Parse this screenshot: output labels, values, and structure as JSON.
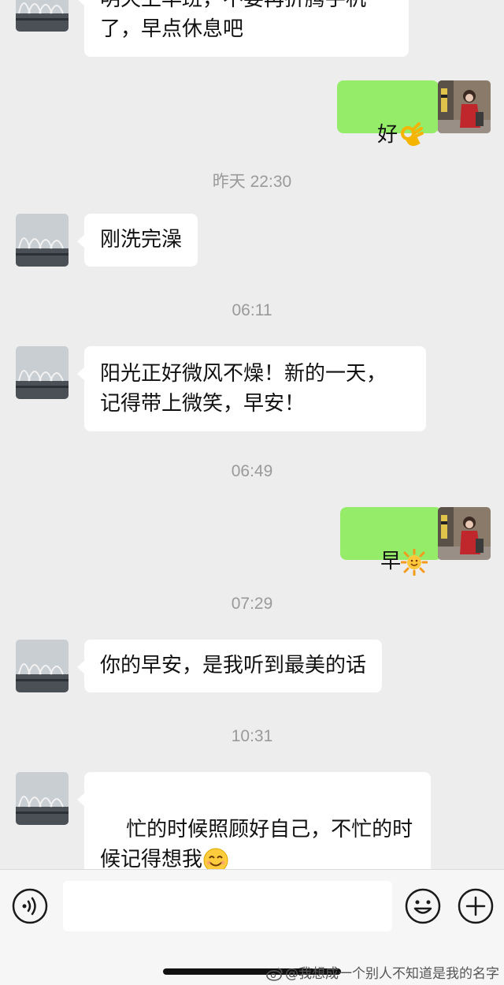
{
  "chat": {
    "timestamps": [
      "昨天 22:30",
      "06:11",
      "06:49",
      "07:29",
      "10:31"
    ],
    "messages": [
      {
        "side": "left",
        "text": "明天上早班，不要再折腾手机\n了，早点休息吧"
      },
      {
        "side": "right",
        "text": "好",
        "emoji": "ok-hand-emoji"
      },
      {
        "side": "left",
        "text": "刚洗完澡"
      },
      {
        "side": "left",
        "text": "阳光正好微风不燥！新的一天，\n记得带上微笑，早安！"
      },
      {
        "side": "right",
        "text": "早",
        "emoji": "sun-emoji"
      },
      {
        "side": "left",
        "text": "你的早安，是我听到最美的话"
      },
      {
        "side": "left",
        "text": "忙的时候照顾好自己，不忙的时\n候记得想我",
        "emoji": "smile-emoji"
      }
    ]
  },
  "input_bar": {
    "voice_icon": "voice-icon",
    "emoji_icon": "emoji-face-icon",
    "plus_icon": "plus-icon"
  },
  "watermark": {
    "text": "@我想成一个别人不知道是我的名字"
  },
  "colors": {
    "background": "#ededed",
    "self_bubble": "#95ec69",
    "other_bubble": "#ffffff"
  }
}
